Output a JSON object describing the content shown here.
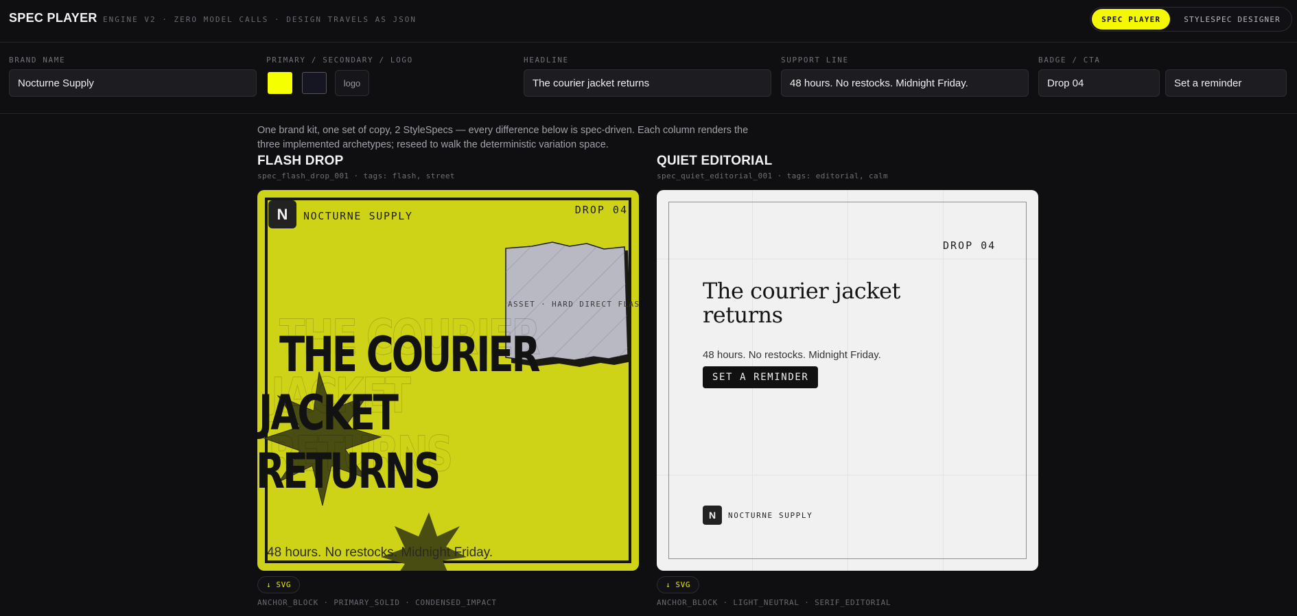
{
  "app": {
    "title": "SPEC PLAYER",
    "subtitle": "ENGINE V2 · ZERO MODEL CALLS · DESIGN TRAVELS AS JSON",
    "tabs": [
      {
        "label": "SPEC PLAYER",
        "active": true
      },
      {
        "label": "STYLESPEC DESIGNER",
        "active": false
      }
    ]
  },
  "fields": {
    "brand_name": {
      "label": "BRAND NAME",
      "value": "Nocturne Supply"
    },
    "colors": {
      "label": "PRIMARY / SECONDARY / LOGO",
      "primary": "#f5ff00",
      "secondary": "#151622",
      "logo_label": "logo"
    },
    "headline": {
      "label": "HEADLINE",
      "value": "The courier jacket returns"
    },
    "support": {
      "label": "SUPPORT LINE",
      "value": "48 hours. No restocks. Midnight Friday."
    },
    "badge_cta": {
      "label": "BADGE / CTA",
      "badge": "Drop 04",
      "cta": "Set a reminder"
    }
  },
  "intro": "One brand kit, one set of copy, 2 StyleSpecs — every difference below is spec-driven. Each column renders the three implemented archetypes; reseed to walk the deterministic variation space.",
  "columns": [
    {
      "title": "FLASH DROP",
      "meta": "spec_flash_drop_001 · tags: flash, street",
      "card": {
        "logo_letter": "N",
        "brand": "NOCTURNE SUPPLY",
        "badge": "DROP 04",
        "asset_label": "ASSET · HARD DIRECT FLASH",
        "headline_lines": [
          "THE COURIER",
          "JACKET",
          "RETURNS"
        ],
        "support": "48 hours. No restocks. Midnight Friday.",
        "bg": "#cfd318"
      },
      "download": "↓ SVG",
      "archetypes": "ANCHOR_BLOCK · PRIMARY_SOLID · CONDENSED_IMPACT"
    },
    {
      "title": "QUIET EDITORIAL",
      "meta": "spec_quiet_editorial_001 · tags: editorial, calm",
      "card": {
        "logo_letter": "N",
        "brand": "NOCTURNE SUPPLY",
        "badge": "DROP 04",
        "headline": "The courier jacket returns",
        "support": "48 hours. No restocks. Midnight Friday.",
        "cta": "SET A REMINDER",
        "bg": "#f1f1f1"
      },
      "download": "↓ SVG",
      "archetypes": "ANCHOR_BLOCK · LIGHT_NEUTRAL · SERIF_EDITORIAL"
    }
  ]
}
